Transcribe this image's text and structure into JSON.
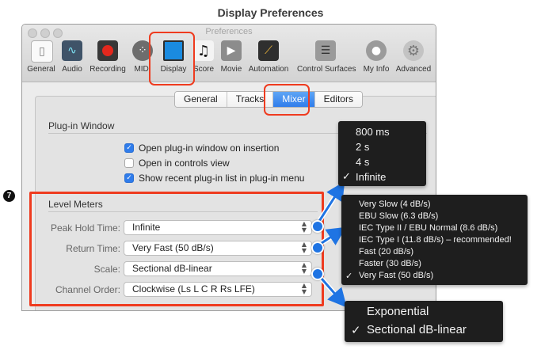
{
  "page_title": "Display Preferences",
  "window": {
    "title": "Preferences"
  },
  "toolbar": [
    {
      "label": "General",
      "icon": "general-icon"
    },
    {
      "label": "Audio",
      "icon": "audio-icon"
    },
    {
      "label": "Recording",
      "icon": "recording-icon"
    },
    {
      "label": "MIDI",
      "icon": "midi-icon"
    },
    {
      "label": "Display",
      "icon": "display-icon"
    },
    {
      "label": "Score",
      "icon": "score-icon"
    },
    {
      "label": "Movie",
      "icon": "movie-icon"
    },
    {
      "label": "Automation",
      "icon": "automation-icon"
    },
    {
      "label": "Control Surfaces",
      "icon": "control-surfaces-icon"
    },
    {
      "label": "My Info",
      "icon": "my-info-icon"
    },
    {
      "label": "Advanced",
      "icon": "advanced-icon"
    }
  ],
  "tabs": [
    {
      "label": "General",
      "active": false
    },
    {
      "label": "Tracks",
      "active": false
    },
    {
      "label": "Mixer",
      "active": true
    },
    {
      "label": "Editors",
      "active": false
    }
  ],
  "plugin_window": {
    "title": "Plug-in Window",
    "options": [
      {
        "label": "Open plug-in window on insertion",
        "checked": true
      },
      {
        "label": "Open in controls view",
        "checked": false
      },
      {
        "label": "Show recent plug-in list in plug-in menu",
        "checked": true
      }
    ]
  },
  "level_meters": {
    "title": "Level Meters",
    "badge": "7",
    "rows": [
      {
        "label": "Peak Hold Time:",
        "value": "Infinite"
      },
      {
        "label": "Return Time:",
        "value": "Very Fast (50 dB/s)"
      },
      {
        "label": "Scale:",
        "value": "Sectional dB-linear"
      },
      {
        "label": "Channel Order:",
        "value": "Clockwise (Ls L C R Rs LFE)"
      }
    ]
  },
  "menus": {
    "peak_hold": {
      "items": [
        "800 ms",
        "2 s",
        "4 s",
        "Infinite"
      ],
      "selected": 3
    },
    "return_time": {
      "items": [
        "Very Slow (4 dB/s)",
        "EBU Slow (6.3 dB/s)",
        "IEC Type II / EBU Normal (8.6 dB/s)",
        "IEC Type I (11.8 dB/s) – recommended!",
        "Fast (20 dB/s)",
        "Faster (30 dB/s)",
        "Very Fast (50 dB/s)"
      ],
      "selected": 6
    },
    "scale": {
      "items": [
        "Exponential",
        "Sectional dB-linear"
      ],
      "selected": 1
    }
  },
  "glyphs": {
    "check": "✓",
    "popup_arrows": "▲▼"
  },
  "colors": {
    "accent": "#2f7ceb",
    "highlight": "#ef3b1f",
    "menu_bg": "#1e1e1e",
    "connector": "#1f74e3"
  }
}
